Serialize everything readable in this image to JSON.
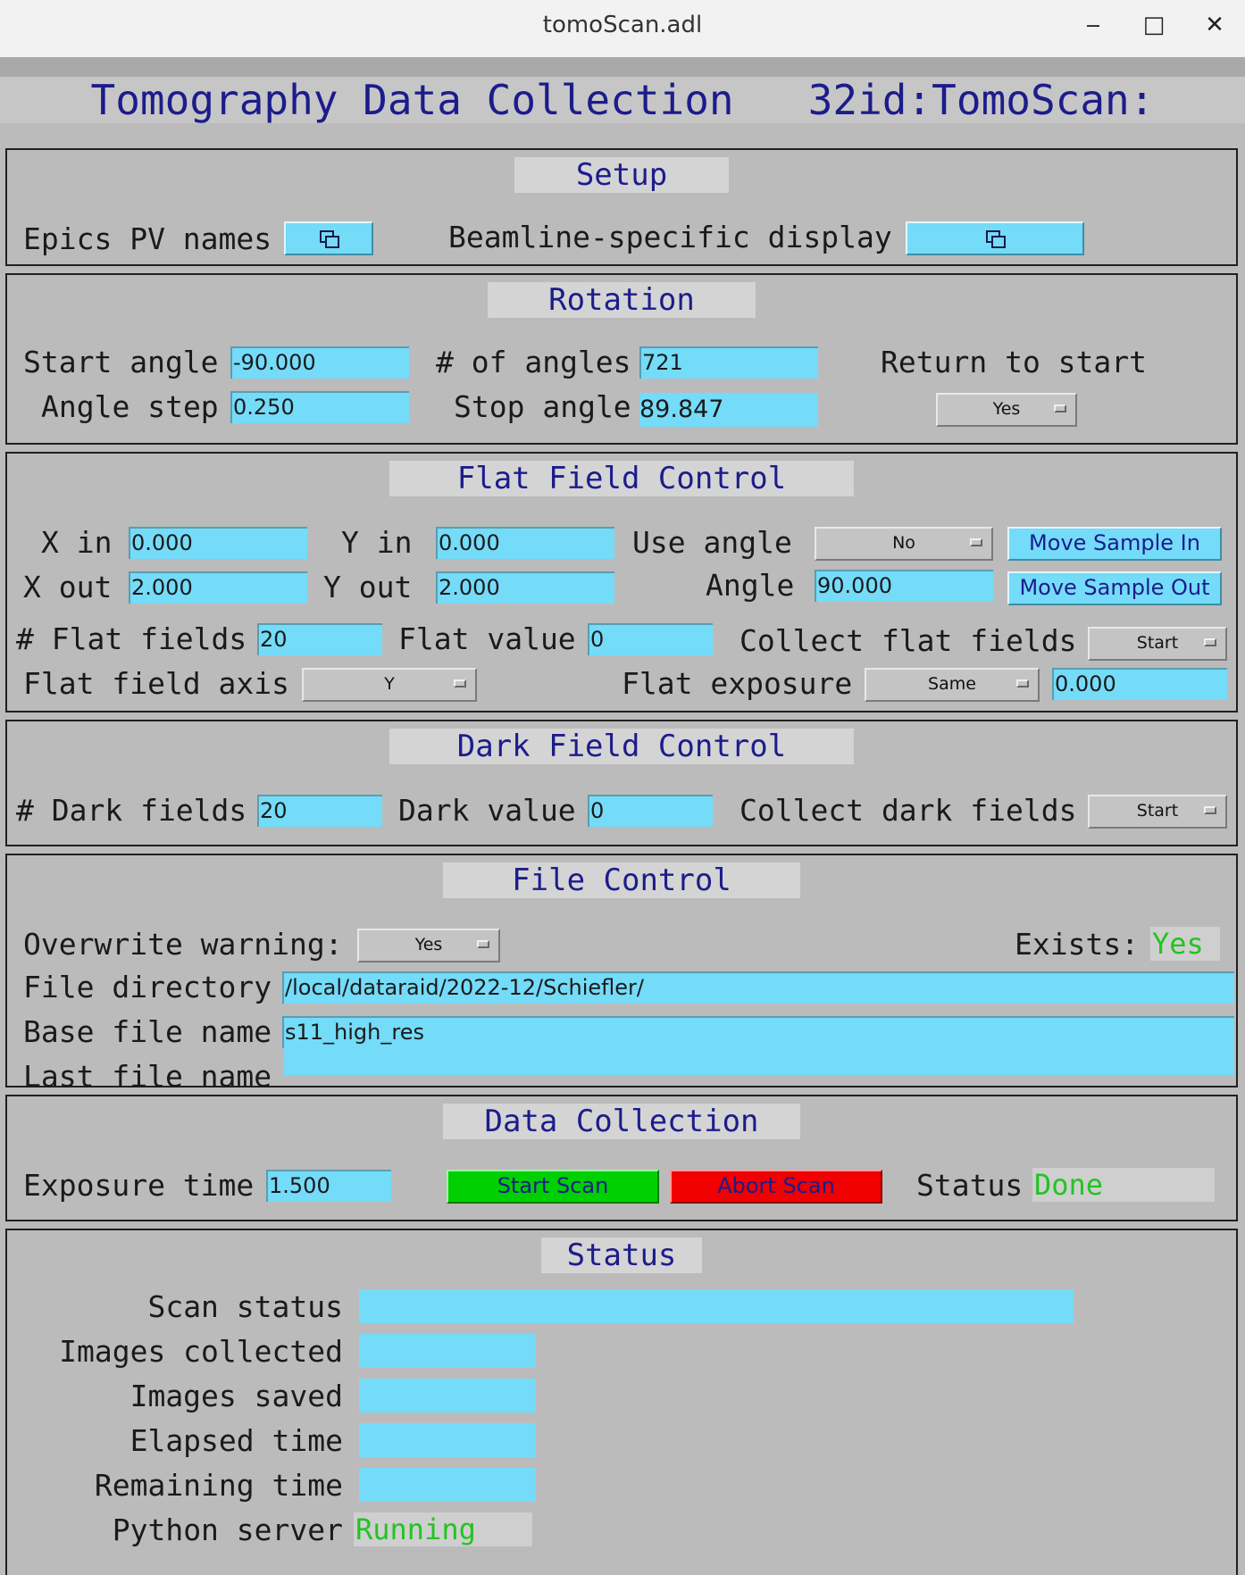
{
  "window": {
    "title": "tomoScan.adl",
    "minimize": "‒",
    "maximize": "□",
    "close": "✕"
  },
  "header": {
    "title": "Tomography Data Collection",
    "prefix": "32id:TomoScan:"
  },
  "setup": {
    "heading": "Setup",
    "epics_label": "Epics PV names",
    "beamline_label": "Beamline-specific display",
    "related_display_icon": "related-display-icon"
  },
  "rotation": {
    "heading": "Rotation",
    "start_angle_label": "Start angle",
    "start_angle": "-90.000",
    "num_angles_label": "# of angles",
    "num_angles": "721",
    "return_label": "Return to start",
    "return_value": "Yes",
    "angle_step_label": "Angle step",
    "angle_step": "0.250",
    "stop_angle_label": "Stop angle",
    "stop_angle": "89.847"
  },
  "flat": {
    "heading": "Flat Field Control",
    "x_in_label": "X in",
    "x_in": "0.000",
    "y_in_label": "Y in",
    "y_in": "0.000",
    "use_angle_label": "Use angle",
    "use_angle": "No",
    "move_in": "Move Sample In",
    "x_out_label": "X out",
    "x_out": "2.000",
    "y_out_label": "Y out",
    "y_out": "2.000",
    "angle_label": "Angle",
    "angle": "90.000",
    "move_out": "Move Sample Out",
    "num_label": "# Flat fields",
    "num": "20",
    "value_label": "Flat value",
    "value": "0",
    "collect_label": "Collect flat fields",
    "collect": "Start",
    "axis_label": "Flat field axis",
    "axis": "Y",
    "exposure_label": "Flat exposure",
    "exposure_mode": "Same",
    "exposure": "0.000"
  },
  "dark": {
    "heading": "Dark Field Control",
    "num_label": "# Dark fields",
    "num": "20",
    "value_label": "Dark value",
    "value": "0",
    "collect_label": "Collect dark fields",
    "collect": "Start"
  },
  "file": {
    "heading": "File Control",
    "overwrite_label": "Overwrite warning:",
    "overwrite": "Yes",
    "exists_label": "Exists:",
    "exists": "Yes",
    "dir_label": "File directory",
    "dir": "/local/dataraid/2022-12/Schiefler/",
    "base_label": "Base file name",
    "base": "s11_high_res",
    "last_label": "Last file name",
    "last": ""
  },
  "collection": {
    "heading": "Data Collection",
    "exposure_label": "Exposure time",
    "exposure": "1.500",
    "start": "Start Scan",
    "abort": "Abort Scan",
    "status_label": "Status",
    "status": "Done",
    "start_color": "#00d000",
    "abort_color": "#f00000"
  },
  "status": {
    "heading": "Status",
    "scan_status_label": "Scan status",
    "scan_status": "",
    "images_collected_label": "Images collected",
    "images_collected": "",
    "images_saved_label": "Images saved",
    "images_saved": "",
    "elapsed_label": "Elapsed time",
    "elapsed": "",
    "remaining_label": "Remaining time",
    "remaining": "",
    "python_label": "Python server",
    "python": "Running"
  }
}
